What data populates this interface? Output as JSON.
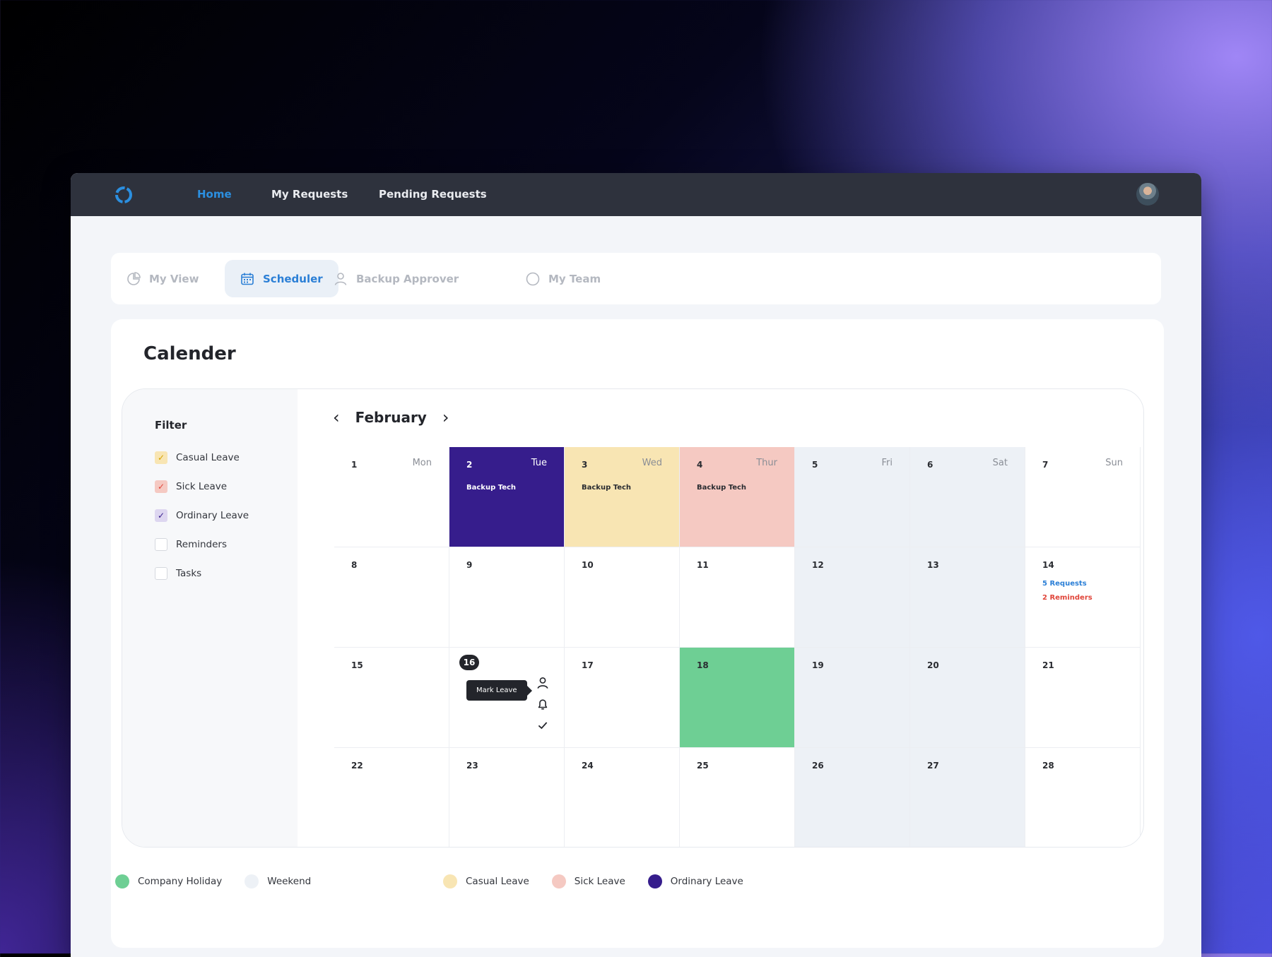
{
  "nav": {
    "items": [
      "Home",
      "My Requests",
      "Pending Requests"
    ]
  },
  "tabs": [
    "My View",
    "Scheduler",
    "Backup Approver",
    "My Team"
  ],
  "title": "Calender",
  "filter": {
    "title": "Filter",
    "items": [
      {
        "label": "Casual Leave",
        "checked": true,
        "color": "#f8e5b3",
        "check_color": "#d6a300"
      },
      {
        "label": "Sick Leave",
        "checked": true,
        "color": "#f5c9c2",
        "check_color": "#e0453a"
      },
      {
        "label": "Ordinary Leave",
        "checked": true,
        "color": "#ddd6f0",
        "check_color": "#361d8c"
      },
      {
        "label": "Reminders",
        "checked": false
      },
      {
        "label": "Tasks",
        "checked": false
      }
    ]
  },
  "calendar": {
    "month": "February",
    "days": [
      {
        "n": "1",
        "dow": "Mon"
      },
      {
        "n": "2",
        "dow": "Tue",
        "type": "ordinary",
        "event": "Backup Tech"
      },
      {
        "n": "3",
        "dow": "Wed",
        "type": "casual",
        "event": "Backup Tech"
      },
      {
        "n": "4",
        "dow": "Thur",
        "type": "sick",
        "event": "Backup Tech"
      },
      {
        "n": "5",
        "dow": "Fri",
        "type": "wkd"
      },
      {
        "n": "6",
        "dow": "Sat",
        "type": "wkd"
      },
      {
        "n": "7",
        "dow": "Sun"
      },
      {
        "n": "8"
      },
      {
        "n": "9"
      },
      {
        "n": "10"
      },
      {
        "n": "11"
      },
      {
        "n": "12",
        "type": "wkd"
      },
      {
        "n": "13",
        "type": "wkd"
      },
      {
        "n": "14",
        "requests": "5 Requests",
        "reminders": "2 Reminders"
      },
      {
        "n": "15"
      },
      {
        "n": "16",
        "selected": true,
        "tooltip": "Mark Leave"
      },
      {
        "n": "17"
      },
      {
        "n": "18",
        "type": "holiday"
      },
      {
        "n": "19",
        "type": "wkd"
      },
      {
        "n": "20",
        "type": "wkd"
      },
      {
        "n": "21"
      },
      {
        "n": "22"
      },
      {
        "n": "23"
      },
      {
        "n": "24"
      },
      {
        "n": "25"
      },
      {
        "n": "26",
        "type": "wkd"
      },
      {
        "n": "27",
        "type": "wkd"
      },
      {
        "n": "28"
      }
    ]
  },
  "legend": [
    {
      "label": "Company Holiday",
      "color": "#6ecf94"
    },
    {
      "label": "Weekend",
      "color": "#edf1f6"
    },
    {
      "label": "Casual Leave",
      "color": "#f8e5b3"
    },
    {
      "label": "Sick Leave",
      "color": "#f5c9c2"
    },
    {
      "label": "Ordinary Leave",
      "color": "#361d8c"
    }
  ],
  "colors": {
    "accent": "#2b8fe0",
    "requests": "#2b7fd6",
    "reminders": "#e0453a"
  }
}
